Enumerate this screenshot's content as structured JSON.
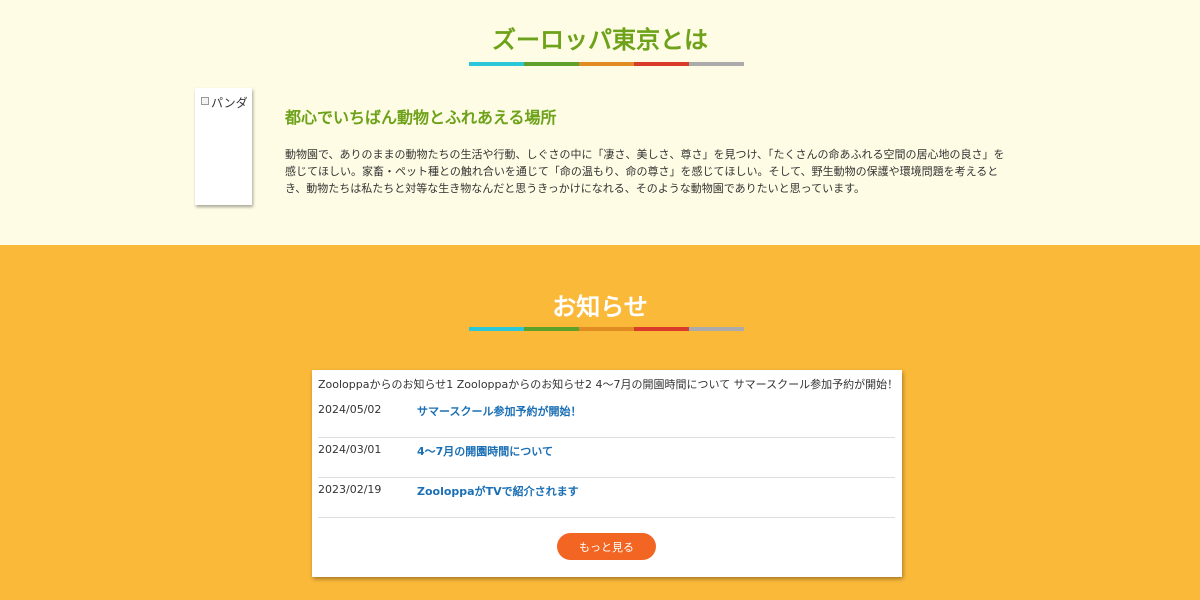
{
  "about": {
    "title": "ズーロッパ東京とは",
    "photo_alt": "パンダ",
    "heading": "都心でいちばん動物とふれあえる場所",
    "description": "動物園で、ありのままの動物たちの生活や行動、しぐさの中に「凄さ、美しさ、尊さ」を見つけ、「たくさんの命あふれる空間の居心地の良さ」を感じてほしい。家畜・ペット種との触れ合いを通じて「命の温もり、命の尊さ」を感じてほしい。そして、野生動物の保護や環境問題を考えるとき、動物たちは私たちと対等な生き物なんだと思うきっかけになれる、そのような動物園でありたいと思っています。"
  },
  "stripe_colors": [
    "#2CC6D9",
    "#5EA02A",
    "#E08C22",
    "#D93B2B",
    "#ABABAB"
  ],
  "news": {
    "title": "お知らせ",
    "ticker": "Zooloppaからのお知らせ1 Zooloppaからのお知らせ2 4〜7月の開園時間について サマースクール参加予約が開始！",
    "items": [
      {
        "date": "2024/05/02",
        "title": "サマースクール参加予約が開始！"
      },
      {
        "date": "2024/03/01",
        "title": "4〜7月の開園時間について"
      },
      {
        "date": "2023/02/19",
        "title": "ZooloppaがTVで紹介されます"
      }
    ],
    "more_label": "もっと見る"
  }
}
